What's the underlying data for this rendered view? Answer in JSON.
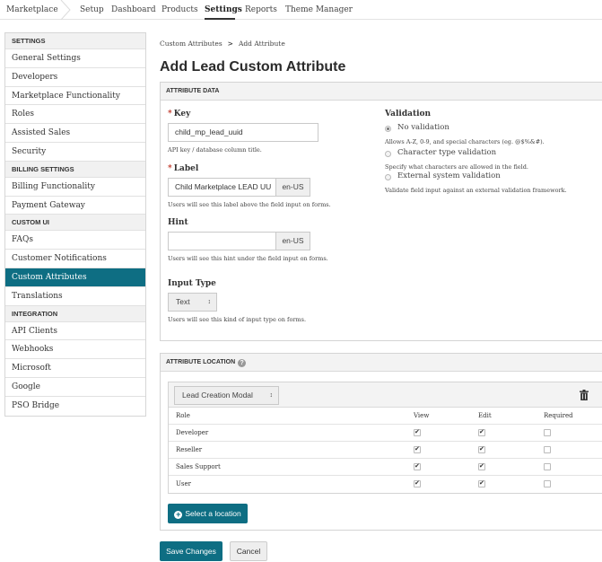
{
  "topnav": {
    "items": [
      {
        "label": "Marketplace"
      },
      {
        "label": "Setup"
      },
      {
        "label": "Dashboard"
      },
      {
        "label": "Products"
      },
      {
        "label": "Settings"
      },
      {
        "label": "Reports"
      },
      {
        "label": "Theme Manager"
      }
    ],
    "active": "Settings"
  },
  "sidebar": {
    "sections": [
      {
        "heading": "SETTINGS",
        "items": [
          "General Settings",
          "Developers",
          "Marketplace Functionality",
          "Roles",
          "Assisted Sales",
          "Security"
        ]
      },
      {
        "heading": "BILLING SETTINGS",
        "items": [
          "Billing Functionality",
          "Payment Gateway"
        ]
      },
      {
        "heading": "CUSTOM UI",
        "items": [
          "FAQs",
          "Customer Notifications",
          "Custom Attributes",
          "Translations"
        ]
      },
      {
        "heading": "INTEGRATION",
        "items": [
          "API Clients",
          "Webhooks",
          "Microsoft",
          "Google",
          "PSO Bridge"
        ]
      }
    ],
    "active": "Custom Attributes",
    "accent_color": "#0e6e83"
  },
  "breadcrumb": {
    "parent": "Custom Attributes",
    "separator": ">",
    "current": "Add Attribute"
  },
  "page_title": "Add Lead Custom Attribute",
  "attribute_data": {
    "heading": "ATTRIBUTE DATA",
    "key": {
      "label": "Key",
      "value": "child_mp_lead_uuid",
      "help": "API key / database column title."
    },
    "label": {
      "label": "Label",
      "value": "Child Marketplace LEAD UU",
      "locale": "en-US",
      "help": "Users will see this label above the field input on forms."
    },
    "hint": {
      "label": "Hint",
      "value": "",
      "locale": "en-US",
      "help": "Users will see this hint under the field input on forms."
    },
    "input_type": {
      "label": "Input Type",
      "value": "Text",
      "help": "Users will see this kind of input type on forms."
    },
    "validation": {
      "label": "Validation",
      "options": [
        {
          "label": "No validation",
          "checked": true,
          "help": "Allows A-Z, 0-9, and special characters (eg. @$%&#)."
        },
        {
          "label": "Character type validation",
          "checked": false,
          "help": "Specify what characters are allowed in the field."
        },
        {
          "label": "External system validation",
          "checked": false,
          "help": "Validate field input against an external validation framework."
        }
      ]
    }
  },
  "attribute_location": {
    "heading": "ATTRIBUTE LOCATION",
    "location_select": "Lead Creation Modal",
    "columns": [
      "Role",
      "View",
      "Edit",
      "Required"
    ],
    "rows": [
      {
        "role": "Developer",
        "view": true,
        "edit": true,
        "required": false
      },
      {
        "role": "Reseller",
        "view": true,
        "edit": true,
        "required": false
      },
      {
        "role": "Sales Support",
        "view": true,
        "edit": true,
        "required": false
      },
      {
        "role": "User",
        "view": true,
        "edit": true,
        "required": false
      }
    ],
    "select_location_label": "Select a location"
  },
  "actions": {
    "save": "Save Changes",
    "cancel": "Cancel"
  }
}
